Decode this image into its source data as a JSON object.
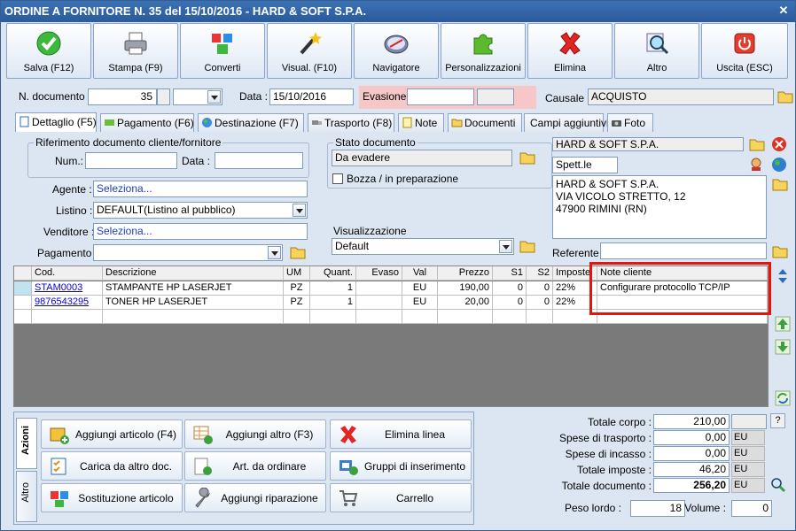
{
  "window": {
    "title": "ORDINE A FORNITORE N. 35 del 15/10/2016 - HARD & SOFT S.P.A."
  },
  "toolbar": [
    {
      "label": "Salva (F12)",
      "icon": "check-icon"
    },
    {
      "label": "Stampa (F9)",
      "icon": "printer-icon"
    },
    {
      "label": "Converti",
      "icon": "convert-icon"
    },
    {
      "label": "Visual. (F10)",
      "icon": "magic-wand-icon"
    },
    {
      "label": "Navigatore",
      "icon": "compass-icon"
    },
    {
      "label": "Personalizzazioni",
      "icon": "puzzle-icon"
    },
    {
      "label": "Elimina",
      "icon": "delete-x-icon"
    },
    {
      "label": "Altro",
      "icon": "magnifier-icon"
    },
    {
      "label": "Uscita (ESC)",
      "icon": "power-icon"
    }
  ],
  "header": {
    "doc_num_label": "N. documento :",
    "doc_num": "35",
    "data_label": "Data :",
    "data": "15/10/2016",
    "evasione_label": "Evasione:",
    "causale_label": "Causale :",
    "causale": "ACQUISTO"
  },
  "tabs": [
    "Dettaglio (F5)",
    "Pagamento (F6)",
    "Destinazione (F7)",
    "Trasporto (F8)",
    "Note",
    "Documenti",
    "Campi aggiuntivi",
    "Foto"
  ],
  "dettaglio": {
    "rif_title": "Riferimento documento cliente/fornitore",
    "num_label": "Num.:",
    "data_label": "Data :",
    "agente_label": "Agente :",
    "agente": "Seleziona...",
    "listino_label": "Listino :",
    "listino": "DEFAULT(Listino al pubblico)",
    "venditore_label": "Venditore :",
    "venditore": "Seleziona...",
    "pagamento_label": "Pagamento :",
    "stato_title": "Stato documento",
    "stato": "Da evadere",
    "bozza": "Bozza / in preparazione",
    "visual_title": "Visualizzazione",
    "visual": "Default",
    "fornitore": "HARD & SOFT S.P.A.",
    "spett": "Spett.le",
    "indirizzo": [
      "HARD & SOFT S.P.A.",
      "VIA VICOLO STRETTO, 12",
      "47900 RIMINI (RN)"
    ],
    "referente_label": "Referente"
  },
  "grid": {
    "columns": [
      "Cod.",
      "Descrizione",
      "UM",
      "Quant.",
      "Evaso",
      "Val",
      "Prezzo",
      "S1",
      "S2",
      "Imposte",
      "Note cliente"
    ],
    "rows": [
      [
        "STAM0003",
        "STAMPANTE HP LASERJET",
        "PZ",
        "1",
        "",
        "EU",
        "190,00",
        "0",
        "0",
        "22%",
        "Configurare protocollo TCP/IP"
      ],
      [
        "9876543295",
        "TONER HP LASERJET",
        "PZ",
        "1",
        "",
        "EU",
        "20,00",
        "0",
        "0",
        "22%",
        ""
      ]
    ]
  },
  "actions": {
    "vtab1": "Azioni",
    "vtab2": "Altro",
    "buttons": [
      "Aggiungi articolo (F4)",
      "Aggiungi altro (F3)",
      "Elimina linea",
      "Carica da altro doc.",
      "Art. da ordinare",
      "Gruppi di inserimento",
      "Sostituzione articolo",
      "Aggiungi riparazione",
      "Carrello"
    ]
  },
  "totals": {
    "corpo_label": "Totale corpo :",
    "corpo": "210,00",
    "trasporto_label": "Spese di trasporto :",
    "trasporto": "0,00",
    "incasso_label": "Spese di incasso :",
    "incasso": "0,00",
    "imposte_label": "Totale imposte :",
    "imposte": "46,20",
    "documento_label": "Totale documento :",
    "documento": "256,20",
    "currency": "EU",
    "help": "?",
    "peso_label": "Peso lordo :",
    "peso": "18",
    "volume_label": "Volume :",
    "volume": "0"
  }
}
